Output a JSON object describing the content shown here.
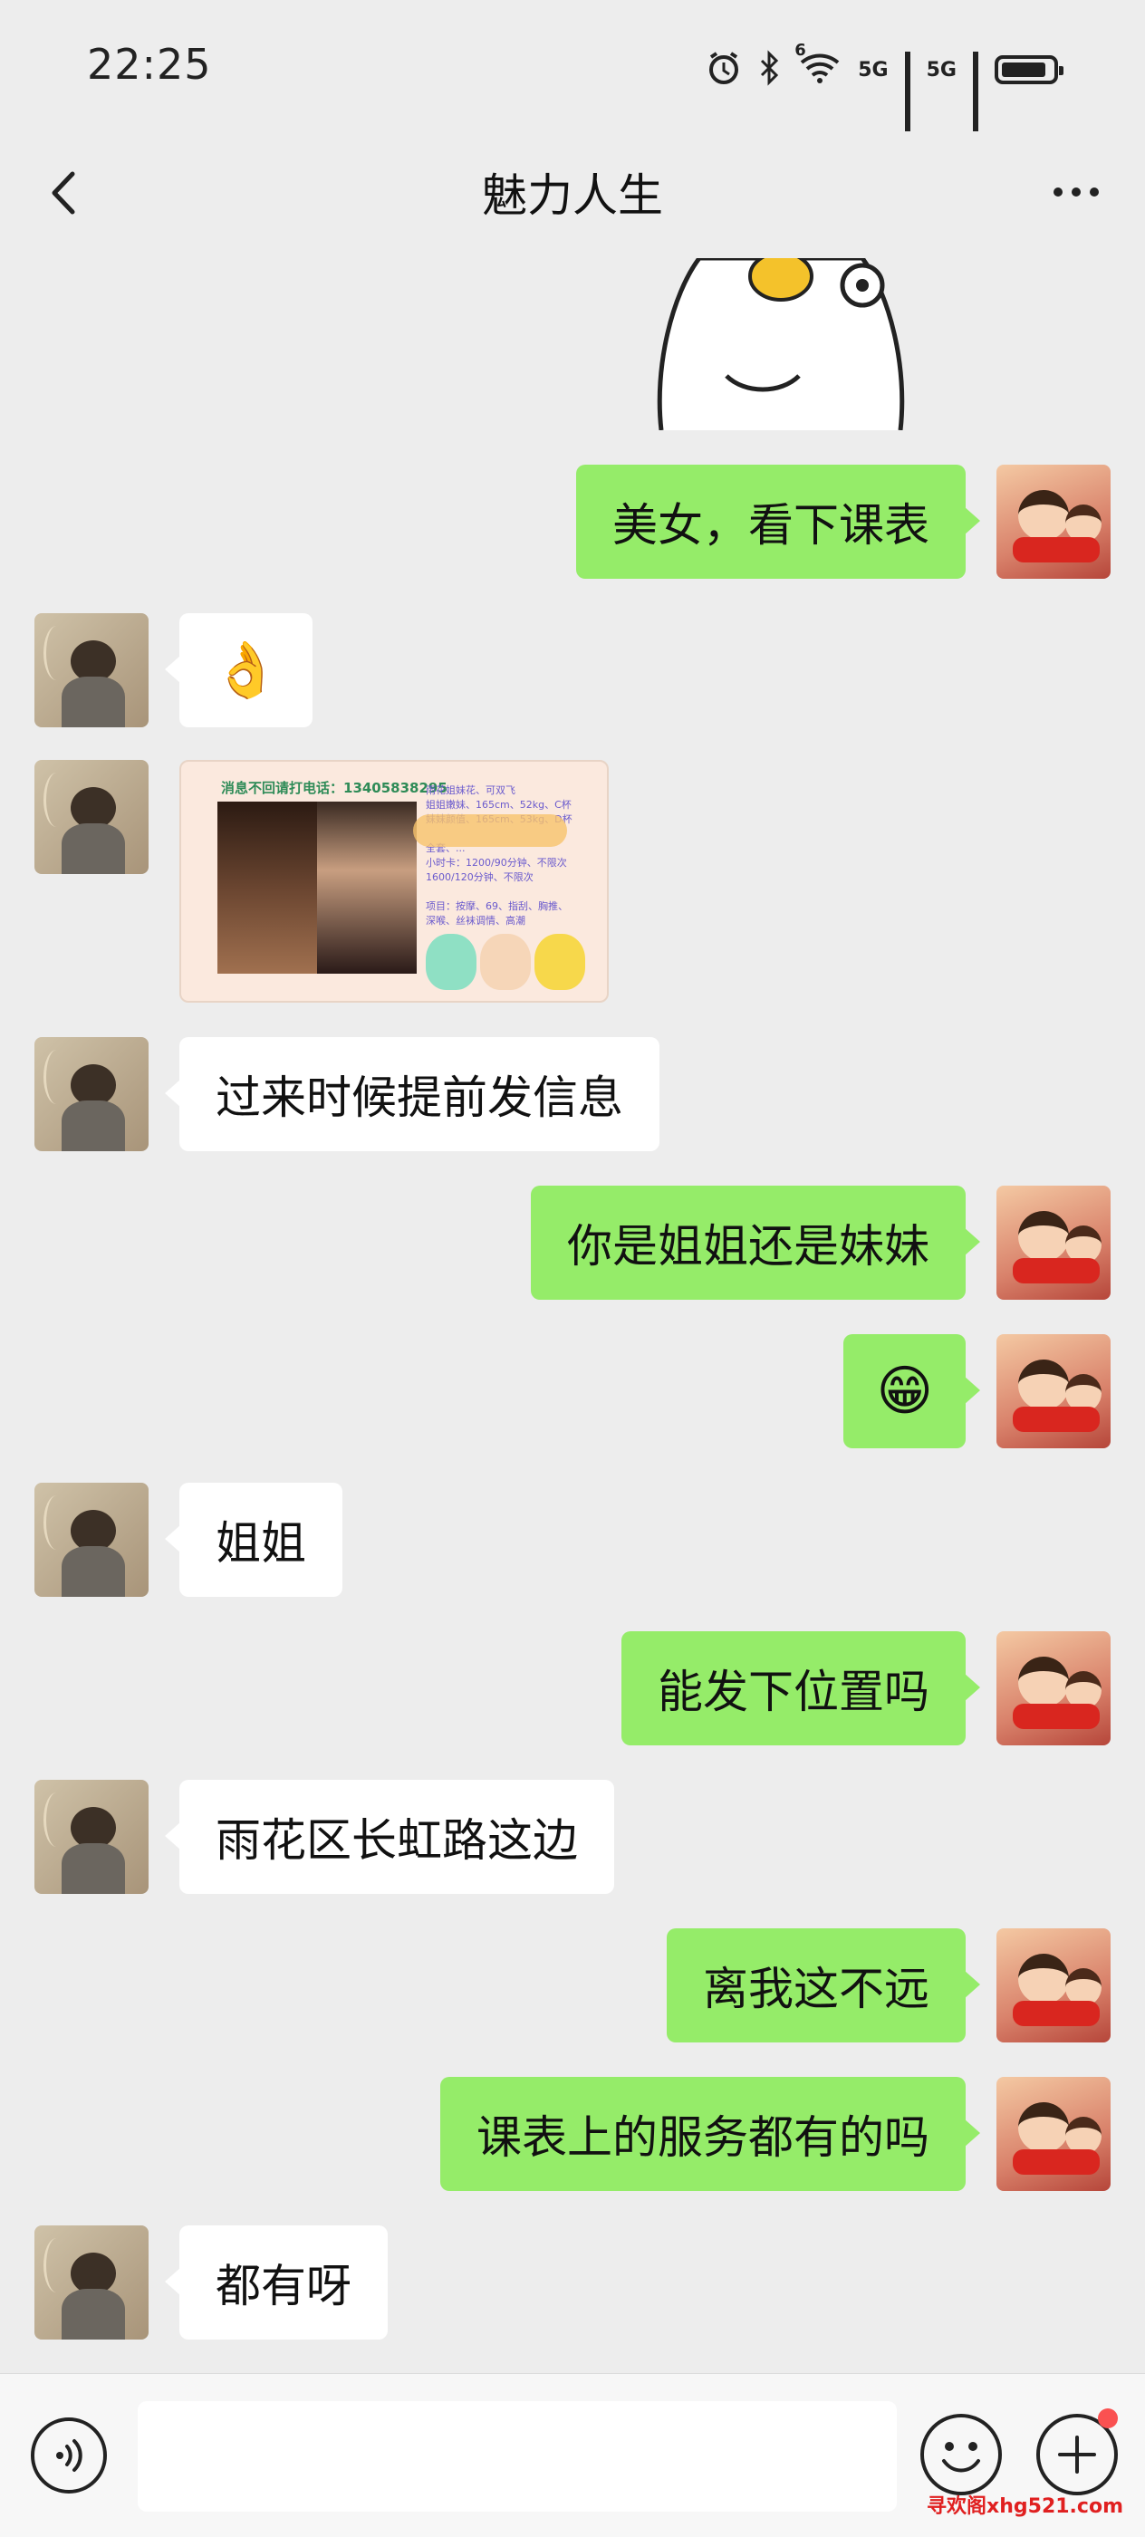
{
  "status_bar": {
    "time": "22:25",
    "network_1": "5G",
    "network_2": "5G",
    "wifi_label": "6",
    "icons": [
      "alarm-icon",
      "bluetooth-icon",
      "wifi-icon",
      "signal-icon",
      "battery-icon"
    ]
  },
  "nav": {
    "title": "魅力人生"
  },
  "messages": [
    {
      "side": "right",
      "type": "text",
      "text": "美女，看下课表"
    },
    {
      "side": "left",
      "type": "emoji",
      "text": "👌"
    },
    {
      "side": "left",
      "type": "image",
      "image": {
        "phone_line": "消息不回请打电话：13405838295",
        "body_text": "雨花姐妹花、可双飞\n姐姐嫩妹、165cm、52kg、C杯\n妹妹颜值、165cm、53kg、D杯\n\n全套、...\n小时卡：1200/90分钟、不限次\n1600/120分钟、不限次\n\n项目：按摩、69、指刮、胸推、\n深喉、丝袜调情、高潮\n\n...WT、..."
      }
    },
    {
      "side": "left",
      "type": "text",
      "text": "过来时候提前发信息"
    },
    {
      "side": "right",
      "type": "text",
      "text": "你是姐姐还是妹妹"
    },
    {
      "side": "right",
      "type": "emoji",
      "text": "😁"
    },
    {
      "side": "left",
      "type": "text",
      "text": "姐姐"
    },
    {
      "side": "right",
      "type": "text",
      "text": "能发下位置吗"
    },
    {
      "side": "left",
      "type": "text",
      "text": "雨花区长虹路这边"
    },
    {
      "side": "right",
      "type": "text",
      "text": "离我这不远"
    },
    {
      "side": "right",
      "type": "text",
      "text": "课表上的服务都有的吗"
    },
    {
      "side": "left",
      "type": "text",
      "text": "都有呀"
    }
  ],
  "input_bar": {
    "placeholder": "",
    "icons": [
      "voice-icon",
      "emoji-icon",
      "plus-icon"
    ]
  },
  "watermark": "寻欢阁xhg521.com",
  "colors": {
    "background": "#ededed",
    "bubble_self": "#95ec69",
    "bubble_other": "#ffffff",
    "badge": "#fa5151"
  }
}
